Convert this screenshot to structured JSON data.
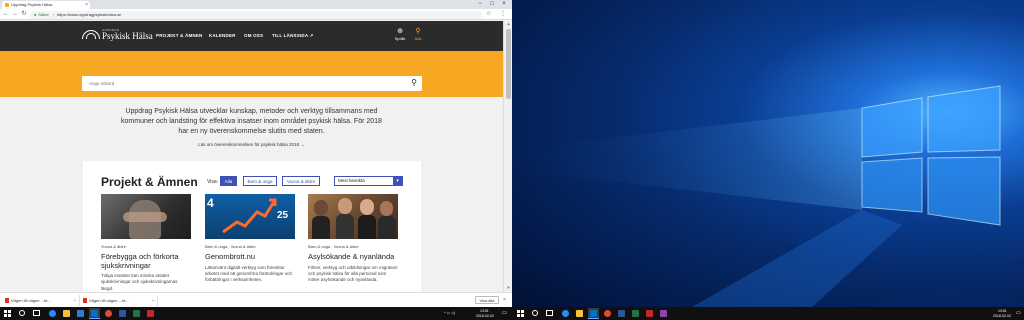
{
  "browser": {
    "tab_title": "Uppdrag Psykisk Hälsa",
    "tab_close": "×",
    "window_controls": {
      "minimize": "−",
      "maximize": "□",
      "close": "×"
    },
    "nav": {
      "back": "←",
      "forward": "→",
      "reload": "↻"
    },
    "url_secure_label": "Säker",
    "url": "https://www.uppdragpsykiskhalsa.se",
    "star": "☆",
    "menu": "⋮"
  },
  "site": {
    "logo_small": "UPPDRAG",
    "logo_text": "Psykisk Hälsa",
    "nav": [
      "PROJEKT & ÄMNEN",
      "KALENDER",
      "OM OSS",
      "TILL LÄNSSIDA ↗"
    ],
    "language_label": "Språk",
    "search_label": "Sök",
    "search_placeholder": "Ange sökord",
    "intro_text": "Uppdrag Psykisk Hälsa utvecklar kunskap, metoder och verktyg tillsammans med kommuner och landsting för effektiva insatser inom området psykisk hälsa. För 2018 har en ny överenskommelse slutits med staten.",
    "intro_link": "Läs om överenskommelsen för psykisk hälsa 2018 →",
    "panel_title": "Projekt & Ämnen",
    "visa_label": "Visa:",
    "filters": [
      "Alla",
      "Barn & unga",
      "Vuxna & äldre"
    ],
    "sort_selected": "Mest besökta",
    "sort_chevron": "▾",
    "cards": [
      {
        "category": "Vuxna & äldre",
        "title": "Förebygga och förkorta sjukskrivningar",
        "description": "Tidiga insatser kan minska antalet sjukskrivningar och sjukskrivningarnas längd."
      },
      {
        "category": "Barn & unga , Vuxna & äldre",
        "title": "Genombrott.nu",
        "description": "Lättanvänt digitalt verktyg som förenklar arbetet med att genomföra förändringar och förbättringar i verksamheten.",
        "image_text_left": "4",
        "image_text_right": "25"
      },
      {
        "category": "Barn & unga , Vuxna & äldre",
        "title": "Asylsökande & nyanlända",
        "description": "Filmer, verktyg och utbildningar om migration och psykisk hälsa för alla personal som möter asylsökande och nyanlända."
      }
    ]
  },
  "downloads": {
    "items": [
      "Vägen till vägen ...ht...",
      "Vägen till vägen ...ht..."
    ],
    "chevron": "^",
    "show_all": "Visa alla",
    "close": "×"
  },
  "taskbar": {
    "left_time": "13:51",
    "left_date": "2018-02-02",
    "right_time": "13:51",
    "right_date": "2018-02-02",
    "colors": {
      "chrome": "#dd4b39",
      "outlook": "#0072c6",
      "word": "#2b579a",
      "excel": "#217346",
      "files": "#f8c13a",
      "acrobat": "#c62828",
      "edge": "#1e90ff"
    }
  }
}
